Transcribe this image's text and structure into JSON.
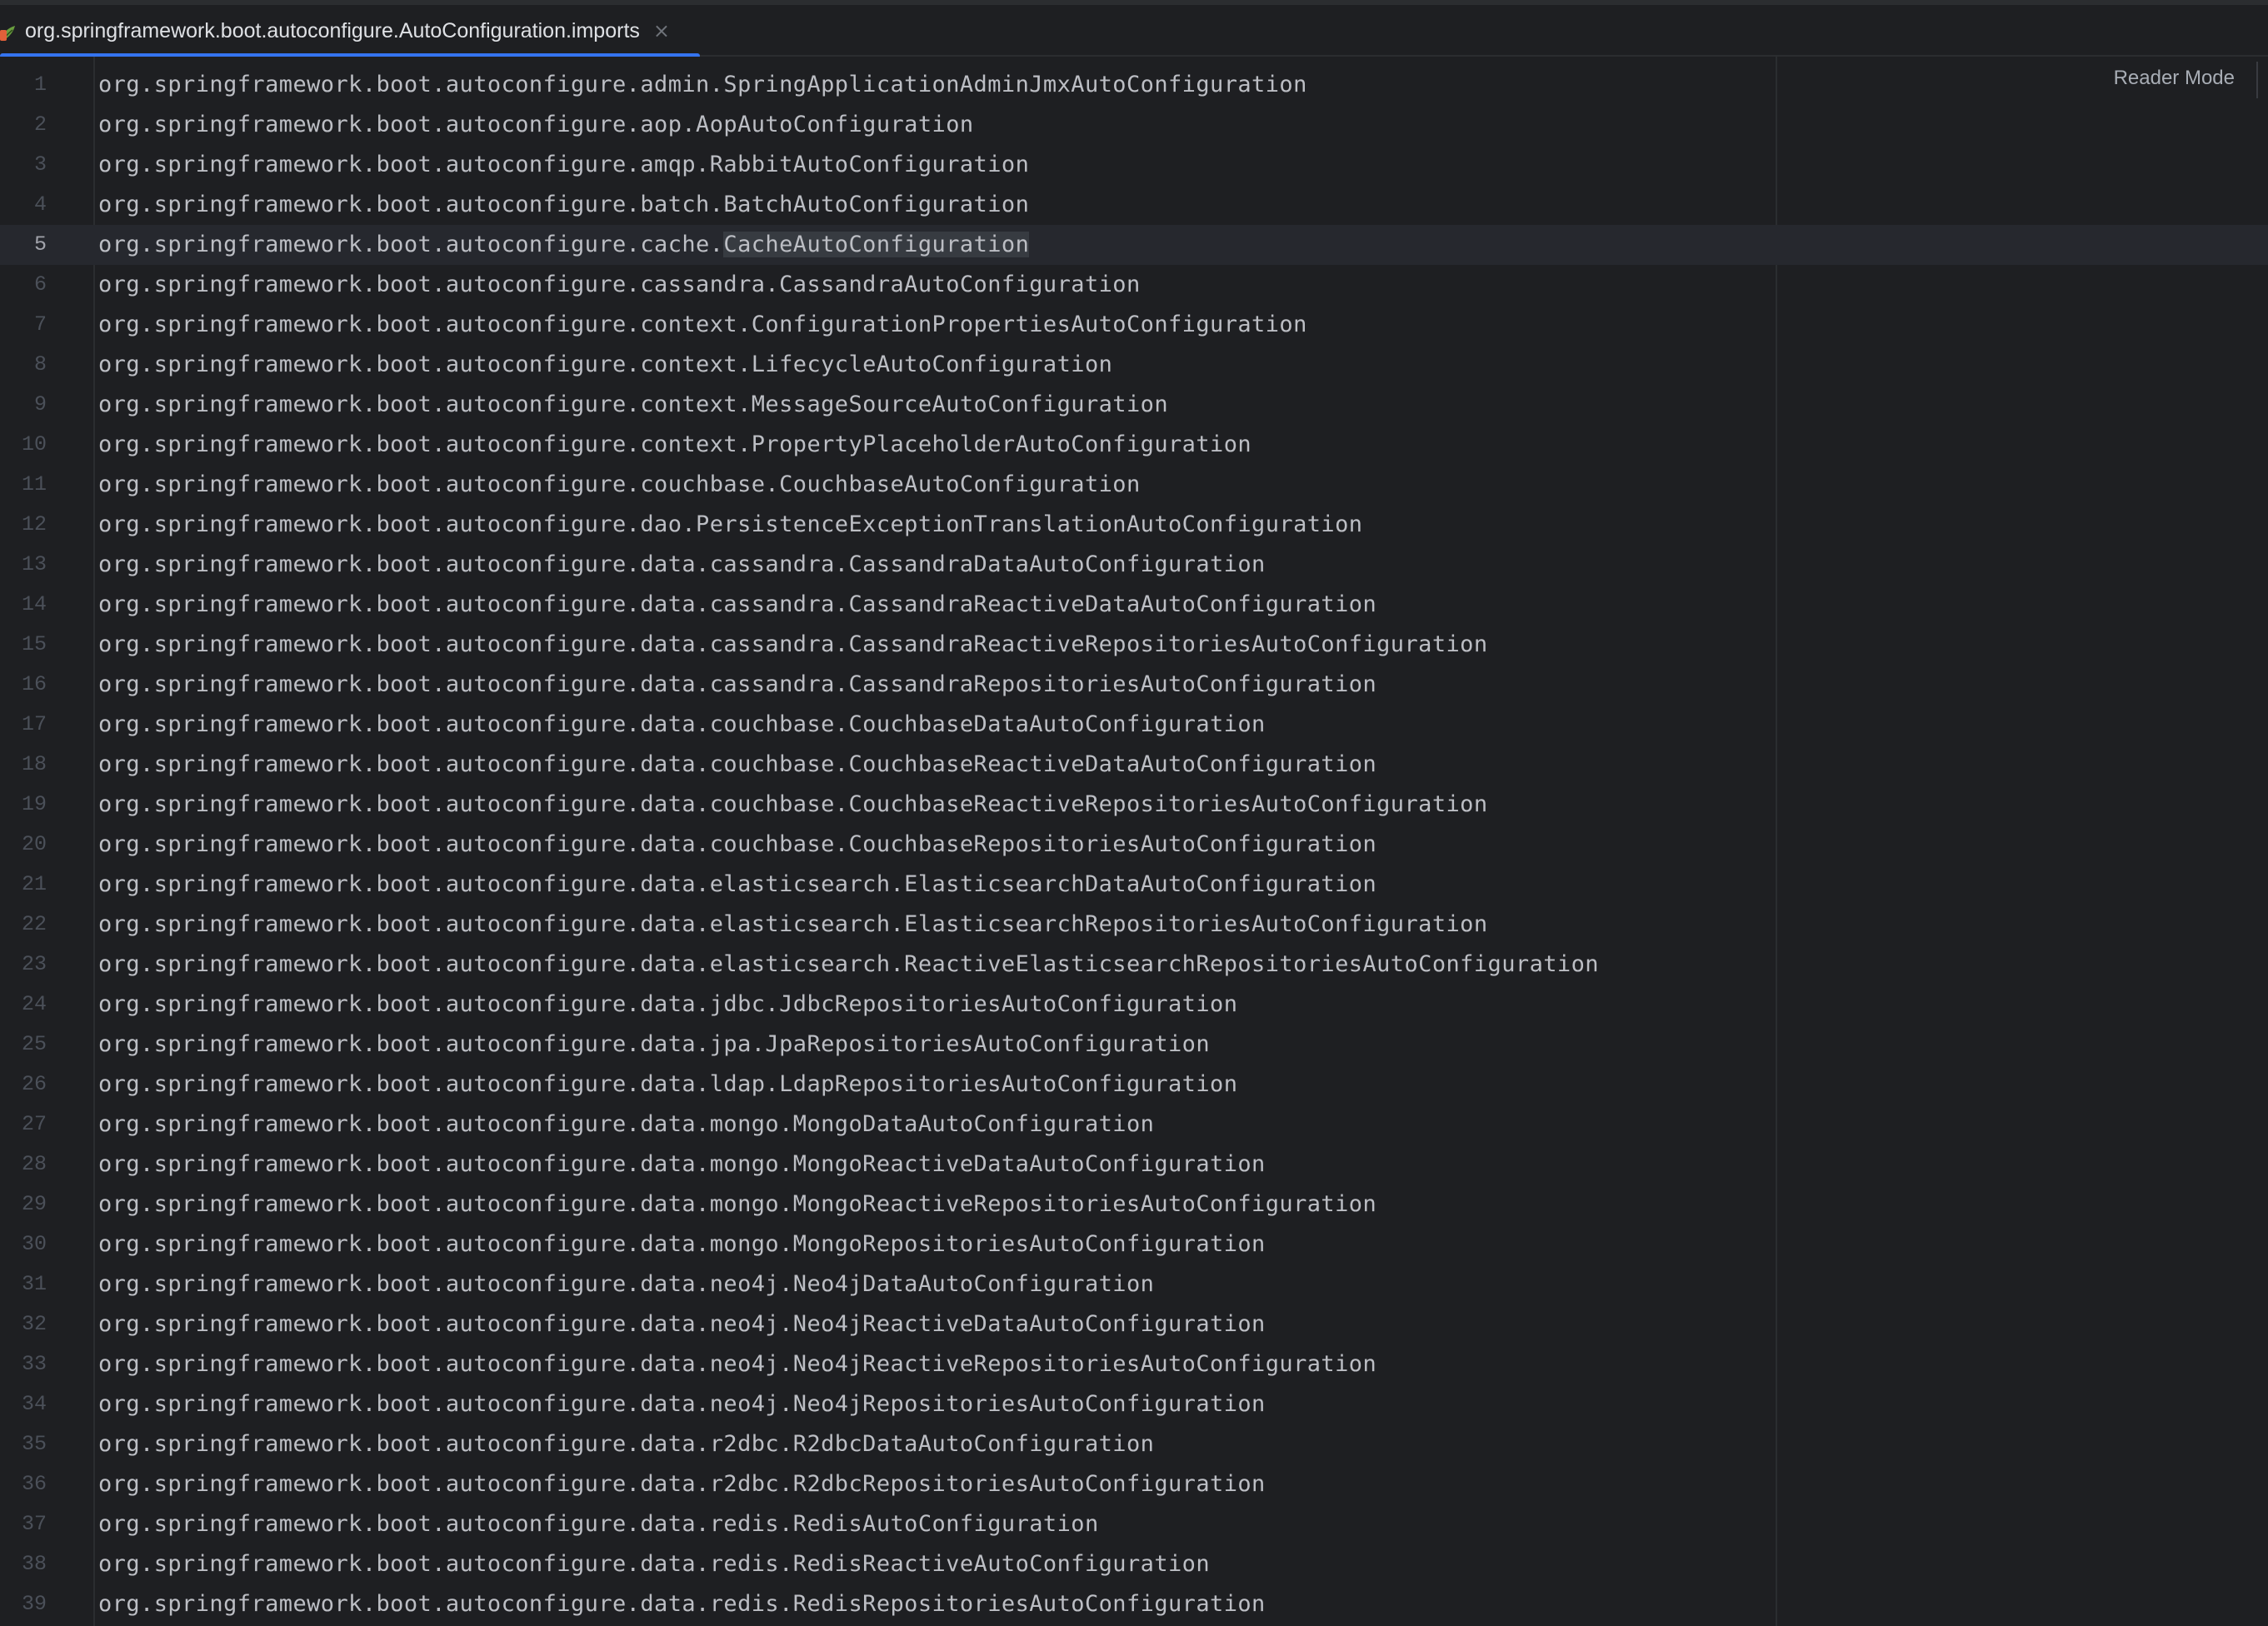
{
  "tab": {
    "title": "org.springframework.boot.autoconfigure.AutoConfiguration.imports",
    "close_glyph": "×",
    "icon": "spring-file-icon"
  },
  "editor": {
    "reader_mode_label": "Reader Mode",
    "current_line": 5,
    "highlighted_word": {
      "line": 5,
      "text": "CacheAutoConfiguration"
    },
    "lines": [
      {
        "n": "1",
        "text": "org.springframework.boot.autoconfigure.admin.SpringApplicationAdminJmxAutoConfiguration"
      },
      {
        "n": "2",
        "text": "org.springframework.boot.autoconfigure.aop.AopAutoConfiguration"
      },
      {
        "n": "3",
        "text": "org.springframework.boot.autoconfigure.amqp.RabbitAutoConfiguration"
      },
      {
        "n": "4",
        "text": "org.springframework.boot.autoconfigure.batch.BatchAutoConfiguration"
      },
      {
        "n": "5",
        "prefix": "org.springframework.boot.autoconfigure.cache.",
        "highlight": "CacheAutoConfiguration"
      },
      {
        "n": "6",
        "text": "org.springframework.boot.autoconfigure.cassandra.CassandraAutoConfiguration"
      },
      {
        "n": "7",
        "text": "org.springframework.boot.autoconfigure.context.ConfigurationPropertiesAutoConfiguration"
      },
      {
        "n": "8",
        "text": "org.springframework.boot.autoconfigure.context.LifecycleAutoConfiguration"
      },
      {
        "n": "9",
        "text": "org.springframework.boot.autoconfigure.context.MessageSourceAutoConfiguration"
      },
      {
        "n": "10",
        "text": "org.springframework.boot.autoconfigure.context.PropertyPlaceholderAutoConfiguration"
      },
      {
        "n": "11",
        "text": "org.springframework.boot.autoconfigure.couchbase.CouchbaseAutoConfiguration"
      },
      {
        "n": "12",
        "text": "org.springframework.boot.autoconfigure.dao.PersistenceExceptionTranslationAutoConfiguration"
      },
      {
        "n": "13",
        "text": "org.springframework.boot.autoconfigure.data.cassandra.CassandraDataAutoConfiguration"
      },
      {
        "n": "14",
        "text": "org.springframework.boot.autoconfigure.data.cassandra.CassandraReactiveDataAutoConfiguration"
      },
      {
        "n": "15",
        "text": "org.springframework.boot.autoconfigure.data.cassandra.CassandraReactiveRepositoriesAutoConfiguration"
      },
      {
        "n": "16",
        "text": "org.springframework.boot.autoconfigure.data.cassandra.CassandraRepositoriesAutoConfiguration"
      },
      {
        "n": "17",
        "text": "org.springframework.boot.autoconfigure.data.couchbase.CouchbaseDataAutoConfiguration"
      },
      {
        "n": "18",
        "text": "org.springframework.boot.autoconfigure.data.couchbase.CouchbaseReactiveDataAutoConfiguration"
      },
      {
        "n": "19",
        "text": "org.springframework.boot.autoconfigure.data.couchbase.CouchbaseReactiveRepositoriesAutoConfiguration"
      },
      {
        "n": "20",
        "text": "org.springframework.boot.autoconfigure.data.couchbase.CouchbaseRepositoriesAutoConfiguration"
      },
      {
        "n": "21",
        "text": "org.springframework.boot.autoconfigure.data.elasticsearch.ElasticsearchDataAutoConfiguration"
      },
      {
        "n": "22",
        "text": "org.springframework.boot.autoconfigure.data.elasticsearch.ElasticsearchRepositoriesAutoConfiguration"
      },
      {
        "n": "23",
        "text": "org.springframework.boot.autoconfigure.data.elasticsearch.ReactiveElasticsearchRepositoriesAutoConfiguration"
      },
      {
        "n": "24",
        "text": "org.springframework.boot.autoconfigure.data.jdbc.JdbcRepositoriesAutoConfiguration"
      },
      {
        "n": "25",
        "text": "org.springframework.boot.autoconfigure.data.jpa.JpaRepositoriesAutoConfiguration"
      },
      {
        "n": "26",
        "text": "org.springframework.boot.autoconfigure.data.ldap.LdapRepositoriesAutoConfiguration"
      },
      {
        "n": "27",
        "text": "org.springframework.boot.autoconfigure.data.mongo.MongoDataAutoConfiguration"
      },
      {
        "n": "28",
        "text": "org.springframework.boot.autoconfigure.data.mongo.MongoReactiveDataAutoConfiguration"
      },
      {
        "n": "29",
        "text": "org.springframework.boot.autoconfigure.data.mongo.MongoReactiveRepositoriesAutoConfiguration"
      },
      {
        "n": "30",
        "text": "org.springframework.boot.autoconfigure.data.mongo.MongoRepositoriesAutoConfiguration"
      },
      {
        "n": "31",
        "text": "org.springframework.boot.autoconfigure.data.neo4j.Neo4jDataAutoConfiguration"
      },
      {
        "n": "32",
        "text": "org.springframework.boot.autoconfigure.data.neo4j.Neo4jReactiveDataAutoConfiguration"
      },
      {
        "n": "33",
        "text": "org.springframework.boot.autoconfigure.data.neo4j.Neo4jReactiveRepositoriesAutoConfiguration"
      },
      {
        "n": "34",
        "text": "org.springframework.boot.autoconfigure.data.neo4j.Neo4jRepositoriesAutoConfiguration"
      },
      {
        "n": "35",
        "text": "org.springframework.boot.autoconfigure.data.r2dbc.R2dbcDataAutoConfiguration"
      },
      {
        "n": "36",
        "text": "org.springframework.boot.autoconfigure.data.r2dbc.R2dbcRepositoriesAutoConfiguration"
      },
      {
        "n": "37",
        "text": "org.springframework.boot.autoconfigure.data.redis.RedisAutoConfiguration"
      },
      {
        "n": "38",
        "text": "org.springframework.boot.autoconfigure.data.redis.RedisReactiveAutoConfiguration"
      },
      {
        "n": "39",
        "text": "org.springframework.boot.autoconfigure.data.redis.RedisRepositoriesAutoConfiguration"
      }
    ]
  },
  "colors": {
    "background": "#1e1f22",
    "text": "#bcbec4",
    "line_number": "#4b5059",
    "accent": "#3574f0",
    "current_line": "#26282e",
    "word_highlight": "#373b41"
  }
}
